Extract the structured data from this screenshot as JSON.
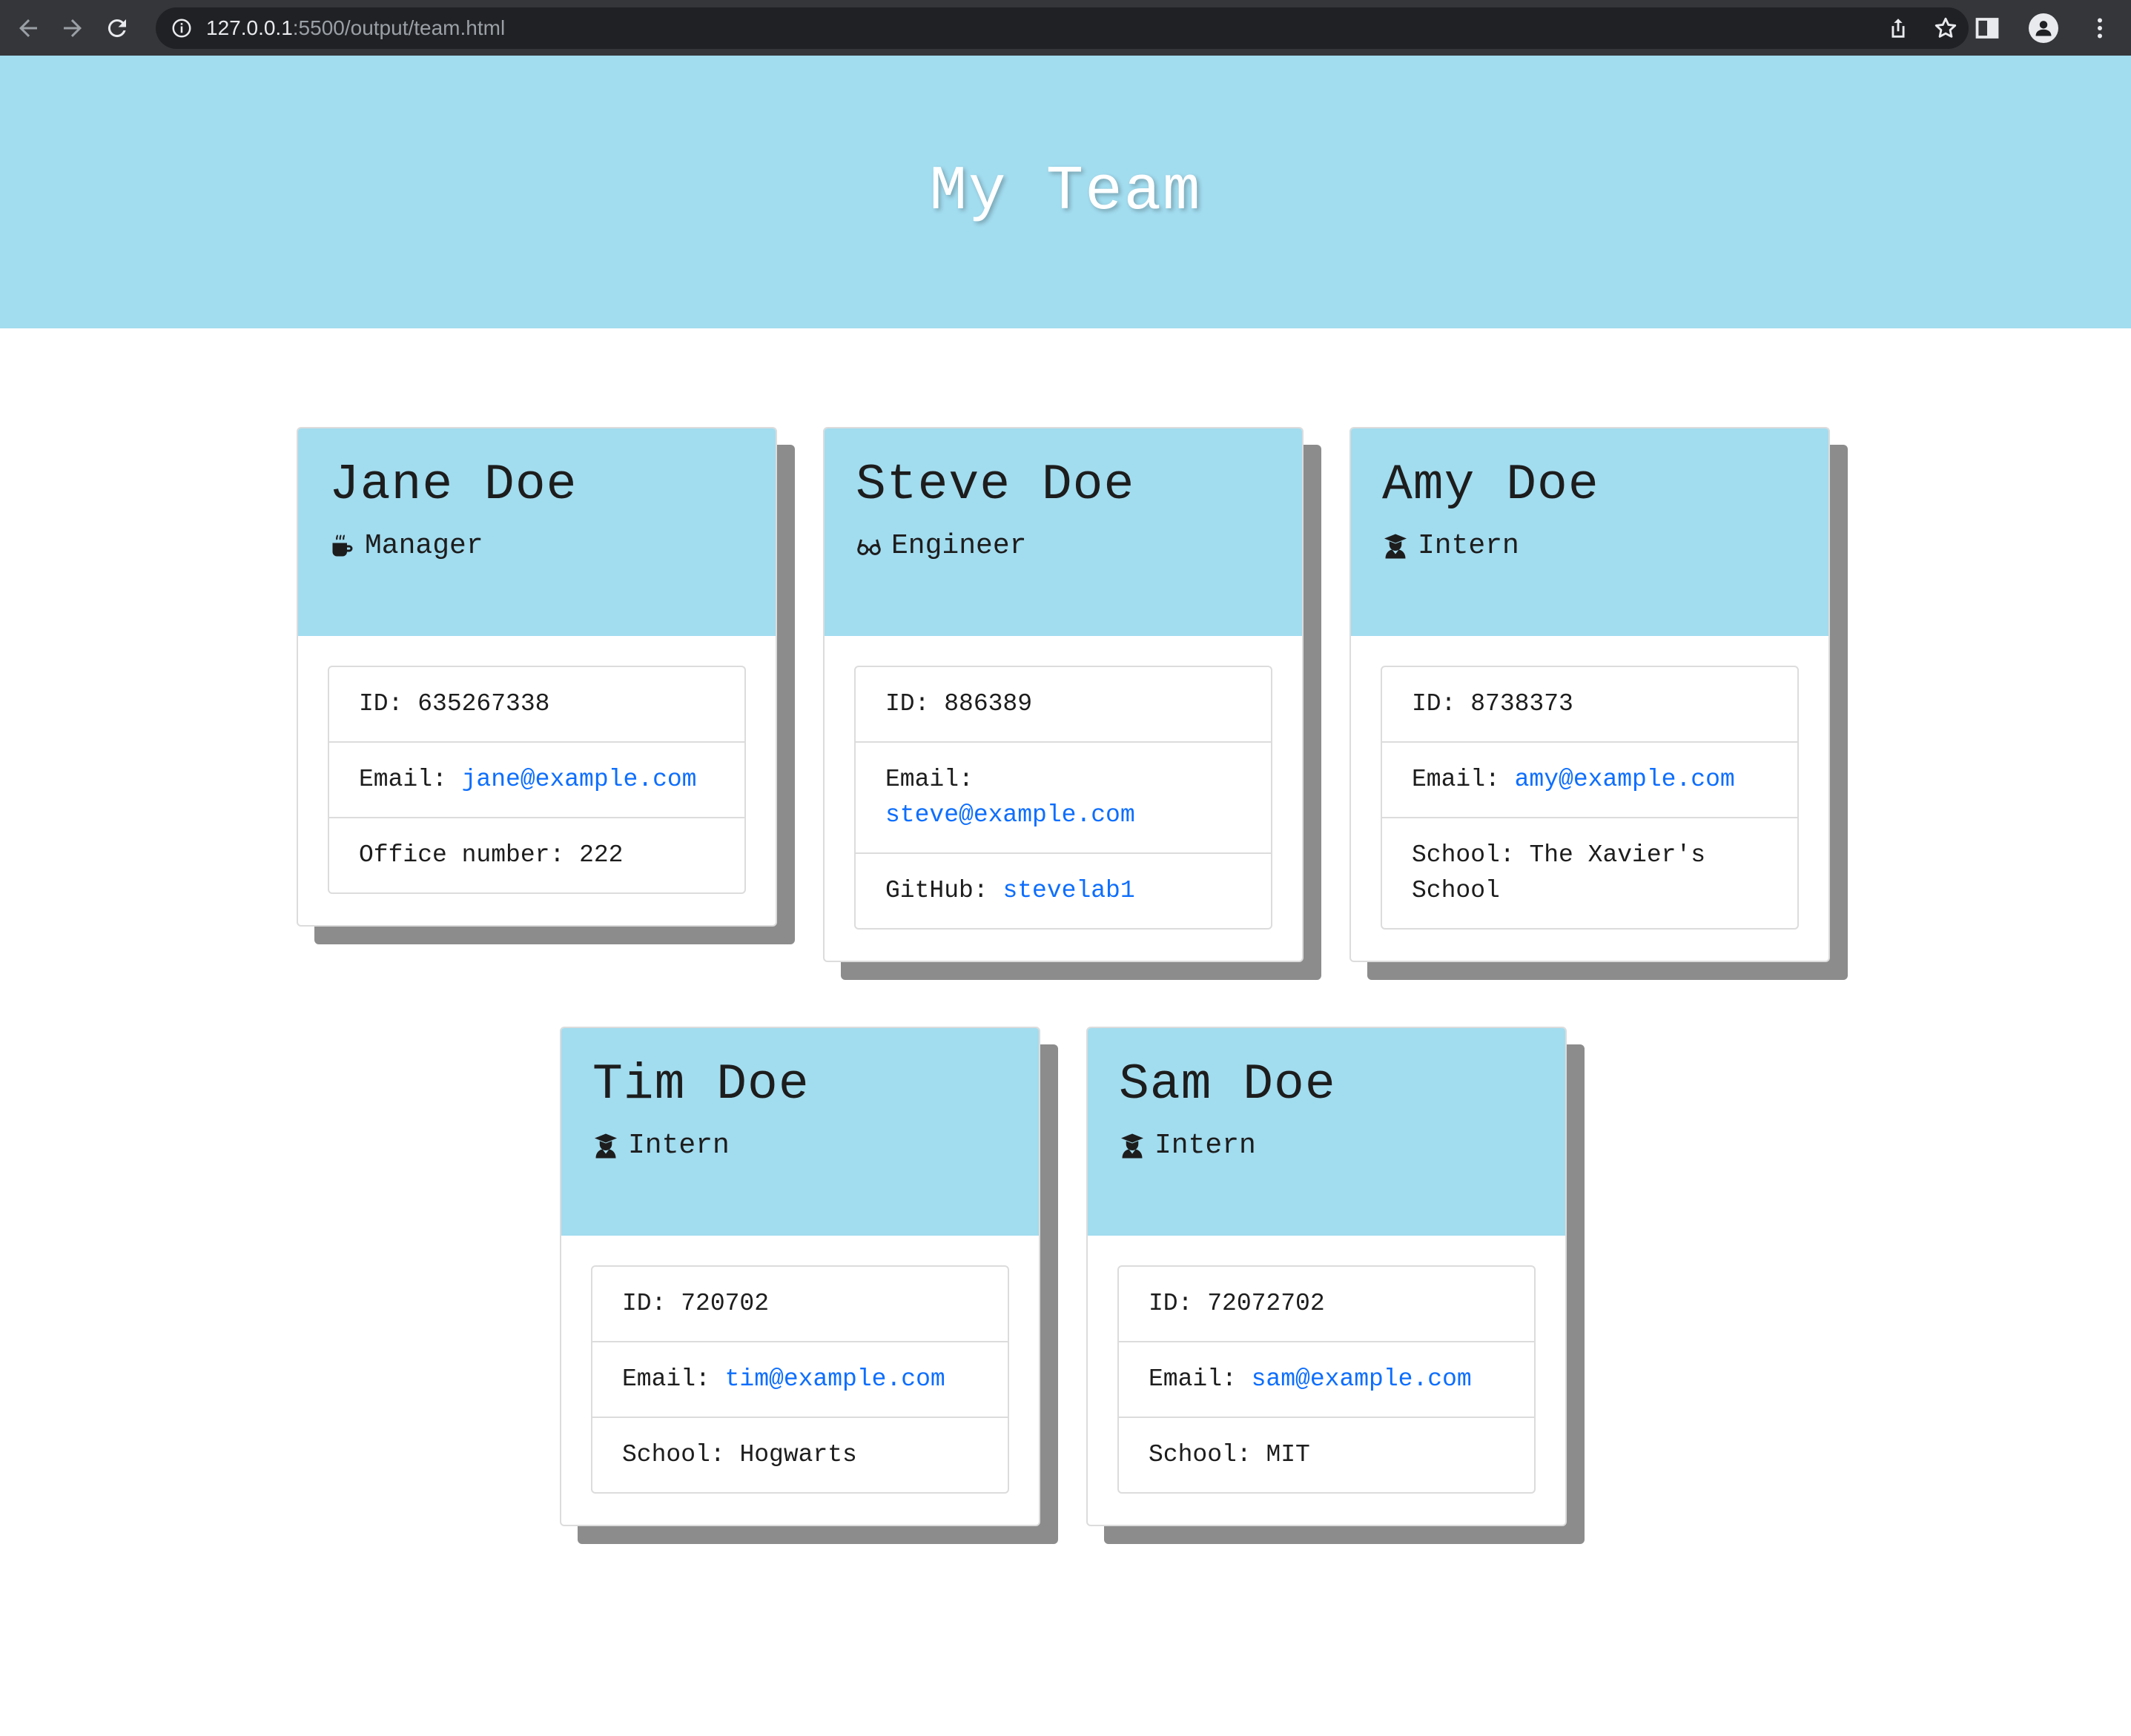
{
  "browser": {
    "url_host": "127.0.0.1",
    "url_path": ":5500/output/team.html"
  },
  "page": {
    "title": "My Team"
  },
  "labels": {
    "id": "ID: ",
    "email": "Email: ",
    "office": "Office number: ",
    "github": "GitHub: ",
    "school": "School: "
  },
  "team": [
    {
      "name": "Jane Doe",
      "role": "Manager",
      "role_icon": "mug-icon",
      "id": "635267338",
      "email": "jane@example.com",
      "office": "222"
    },
    {
      "name": "Steve Doe",
      "role": "Engineer",
      "role_icon": "glasses-icon",
      "id": "886389",
      "email": "steve@example.com",
      "github": "stevelab1"
    },
    {
      "name": "Amy Doe",
      "role": "Intern",
      "role_icon": "graduate-icon",
      "id": "8738373",
      "email": "amy@example.com",
      "school": "The Xavier's School"
    },
    {
      "name": "Tim Doe",
      "role": "Intern",
      "role_icon": "graduate-icon",
      "id": "720702",
      "email": "tim@example.com",
      "school": "Hogwarts"
    },
    {
      "name": "Sam Doe",
      "role": "Intern",
      "role_icon": "graduate-icon",
      "id": "72072702",
      "email": "sam@example.com",
      "school": "MIT"
    }
  ],
  "colors": {
    "header_bg": "#a2dcef",
    "link": "#0d6efd",
    "shadow": "#8c8c8c"
  }
}
